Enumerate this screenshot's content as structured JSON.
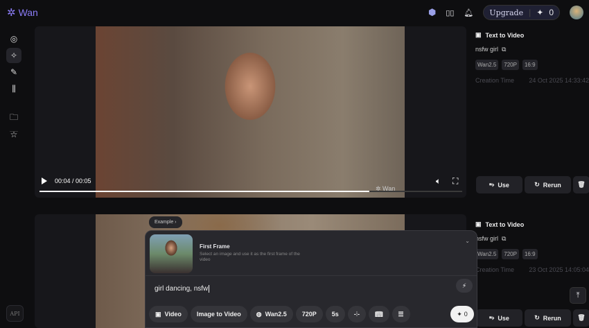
{
  "header": {
    "logo": "Wan",
    "upgrade": "Upgrade",
    "credits": "0"
  },
  "sidebar": {
    "api": "API"
  },
  "videos": [
    {
      "player": {
        "time": "00:04 / 00:05",
        "progress": 0.78,
        "watermark": "Wan"
      },
      "info": {
        "type": "Text to Video",
        "prompt": "nsfw girl",
        "tags": [
          "Wan2.5",
          "720P",
          "16:9"
        ],
        "creation_label": "Creation Time",
        "creation_time": "24 Oct 2025 14:33:42"
      },
      "actions": {
        "use": "Use",
        "rerun": "Rerun"
      }
    },
    {
      "info": {
        "type": "Text to Video",
        "prompt": "nsfw girl",
        "tags": [
          "Wan2.5",
          "720P",
          "16:9"
        ],
        "creation_label": "Creation Time",
        "creation_time": "23 Oct 2025 14:05:04"
      },
      "actions": {
        "use": "Use",
        "rerun": "Rerun"
      }
    }
  ],
  "composer": {
    "example": "Example ›",
    "first_frame_title": "First Frame",
    "first_frame_desc": "Select an image and use it as the first frame of the video",
    "prompt": "girl dancing, nsfw",
    "chips": {
      "mode": "Video",
      "type": "Image to Video",
      "model": "Wan2.5",
      "resolution": "720P",
      "duration": "5s"
    },
    "generate_cost": "0"
  }
}
